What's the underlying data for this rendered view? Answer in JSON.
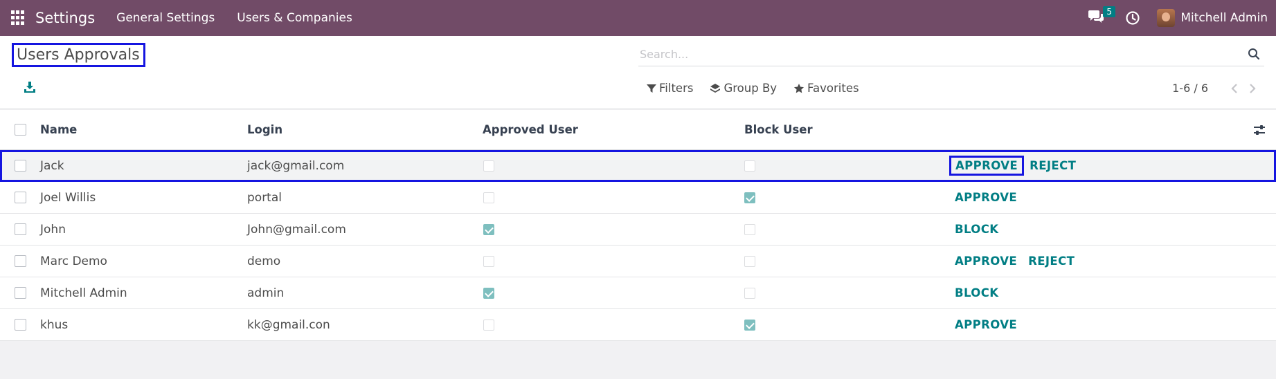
{
  "navbar": {
    "app_title": "Settings",
    "menu": [
      "General Settings",
      "Users & Companies"
    ],
    "message_count": "5",
    "user_name": "Mitchell Admin"
  },
  "control": {
    "page_title": "Users Approvals",
    "search_placeholder": "Search...",
    "filters_label": "Filters",
    "groupby_label": "Group By",
    "favorites_label": "Favorites",
    "pager": "1-6 / 6"
  },
  "table": {
    "columns": {
      "name": "Name",
      "login": "Login",
      "approved": "Approved User",
      "block": "Block User"
    },
    "rows": [
      {
        "name": "Jack",
        "login": "jack@gmail.com",
        "approved": false,
        "blocked": false,
        "actions": [
          "APPROVE",
          "REJECT"
        ]
      },
      {
        "name": "Joel Willis",
        "login": "portal",
        "approved": false,
        "blocked": true,
        "actions": [
          "APPROVE"
        ]
      },
      {
        "name": "John",
        "login": "John@gmail.com",
        "approved": true,
        "blocked": false,
        "actions": [
          "BLOCK"
        ]
      },
      {
        "name": "Marc Demo",
        "login": "demo",
        "approved": false,
        "blocked": false,
        "actions": [
          "APPROVE",
          "REJECT"
        ]
      },
      {
        "name": "Mitchell Admin",
        "login": "admin",
        "approved": true,
        "blocked": false,
        "actions": [
          "BLOCK"
        ]
      },
      {
        "name": "khus",
        "login": "kk@gmail.con",
        "approved": false,
        "blocked": true,
        "actions": [
          "APPROVE"
        ]
      }
    ]
  },
  "colors": {
    "navbar": "#714b67",
    "accent": "#017e84",
    "highlight": "#1515e0"
  }
}
